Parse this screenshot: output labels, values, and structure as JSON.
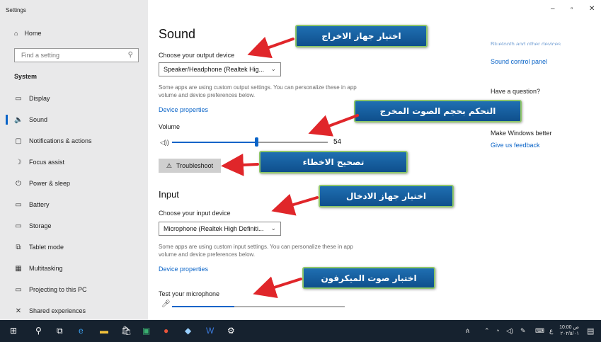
{
  "window": {
    "title": "Settings",
    "minimize": "–",
    "maximize": "▫",
    "close": "✕"
  },
  "sidebar": {
    "home": "Home",
    "search_placeholder": "Find a setting",
    "section": "System",
    "items": [
      {
        "label": "Display",
        "icon": "▭"
      },
      {
        "label": "Sound",
        "icon": "🔈"
      },
      {
        "label": "Notifications & actions",
        "icon": "▢"
      },
      {
        "label": "Focus assist",
        "icon": "☽"
      },
      {
        "label": "Power & sleep",
        "icon": "⏻"
      },
      {
        "label": "Battery",
        "icon": "▭"
      },
      {
        "label": "Storage",
        "icon": "▭"
      },
      {
        "label": "Tablet mode",
        "icon": "⧉"
      },
      {
        "label": "Multitasking",
        "icon": "▦"
      },
      {
        "label": "Projecting to this PC",
        "icon": "▭"
      },
      {
        "label": "Shared experiences",
        "icon": "✕"
      }
    ]
  },
  "main": {
    "title": "Sound",
    "output_label": "Choose your output device",
    "output_value": "Speaker/Headphone (Realtek Hig...",
    "output_note": "Some apps are using custom output settings. You can personalize these in app volume and device preferences below.",
    "output_device_properties": "Device properties",
    "volume_label": "Volume",
    "volume_value": "54",
    "volume_level": 0.54,
    "troubleshoot": "Troubleshoot",
    "input_title": "Input",
    "input_label": "Choose your input device",
    "input_value": "Microphone (Realtek High Definiti...",
    "input_note": "Some apps are using custom input settings. You can personalize these in app volume and device preferences below.",
    "input_device_properties": "Device properties",
    "test_mic_label": "Test your microphone",
    "mic_level": 0.36
  },
  "right": {
    "cut_link": "Bluetooth and other devices",
    "sound_control_panel": "Sound control panel",
    "have_question": "Have a question?",
    "make_better": "Make Windows better",
    "feedback": "Give us feedback"
  },
  "annotations": {
    "output": "اختيار جهاز الاخراج",
    "volume": "التحكم بحجم الصوت المخرج",
    "troubleshoot": "تصحيح الاخطاء",
    "input": "اختيار جهاز الادخال",
    "mic": "اختبار صوت الميكرفون",
    "arrow_color": "#e0262a"
  },
  "taskbar": {
    "time": "10:00 ص",
    "date": "٢٠٢/٥/٠١"
  }
}
